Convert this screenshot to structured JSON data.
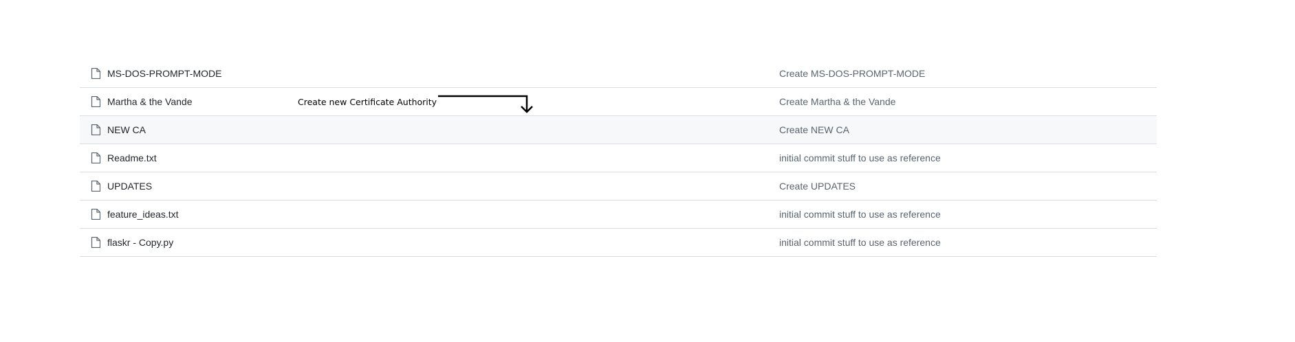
{
  "files": [
    {
      "name": "MS-DOS-PROMPT-MODE",
      "commit": "Create MS-DOS-PROMPT-MODE",
      "icon": "file-icon",
      "highlighted": false
    },
    {
      "name": "Martha & the Vande",
      "commit": "Create Martha & the Vande",
      "icon": "file-icon",
      "highlighted": false
    },
    {
      "name": "NEW CA",
      "commit": "Create NEW CA",
      "icon": "file-icon",
      "highlighted": true
    },
    {
      "name": "Readme.txt",
      "commit": "initial commit stuff to use as reference",
      "icon": "file-icon",
      "highlighted": false
    },
    {
      "name": "UPDATES",
      "commit": "Create UPDATES",
      "icon": "file-icon",
      "highlighted": false
    },
    {
      "name": "feature_ideas.txt",
      "commit": "initial commit stuff to use as reference",
      "icon": "file-icon",
      "highlighted": false
    },
    {
      "name": "flaskr - Copy.py",
      "commit": "initial commit stuff to use as reference",
      "icon": "file-icon",
      "highlighted": false
    }
  ],
  "annotation": {
    "text": "Create new Certificate Authority",
    "icon": "arrow-down-icon"
  },
  "colors": {
    "border": "#d8dee4",
    "highlight_bg": "#f6f8fa",
    "file_text": "#1f2328",
    "commit_text": "#59636e"
  }
}
